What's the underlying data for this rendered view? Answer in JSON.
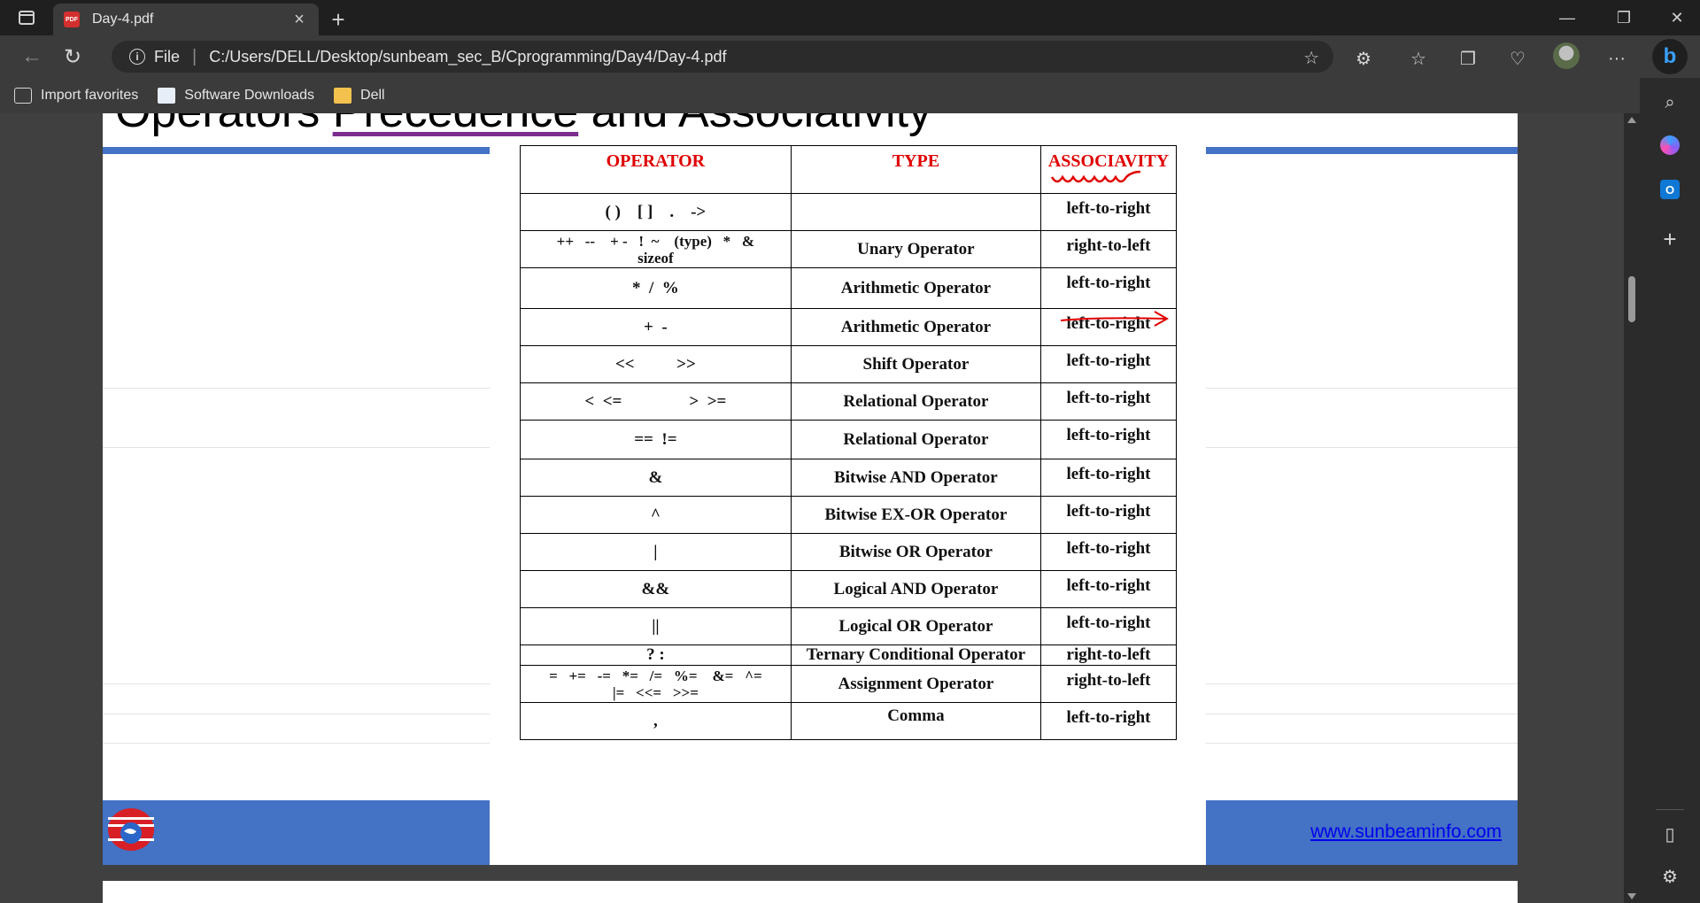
{
  "browser": {
    "tab_title": "Day-4.pdf",
    "tab_icon": "pdf-file-icon",
    "address": {
      "scheme_label": "File",
      "url": "C:/Users/DELL/Desktop/sunbeam_sec_B/Cprogramming/Day4/Day-4.pdf"
    },
    "bookmarks": [
      {
        "label": "Import favorites",
        "icon": "import-icon"
      },
      {
        "label": "Software Downloads",
        "icon": "page-icon"
      },
      {
        "label": "Dell",
        "icon": "folder-icon"
      }
    ],
    "window_controls": {
      "minimize": "—",
      "restore": "❐",
      "close": "✕"
    }
  },
  "slide": {
    "title_part1": "Operators ",
    "title_part2": "Precedence",
    "title_part3": " and Associativity",
    "footer_link": "www.sunbeaminfo.com",
    "accent_color": "#4472c4",
    "header_color": "#e00000"
  },
  "table": {
    "headers": [
      "OPERATOR",
      "TYPE",
      "ASSOCIAVITY"
    ],
    "rows": [
      {
        "op": "( )    [ ]    .    ->",
        "type": "",
        "assoc": "left-to-right"
      },
      {
        "op": "++   --    + -   !  ~    (type)   *   &\nsizeof",
        "type": "Unary Operator",
        "assoc": "right-to-left"
      },
      {
        "op": "*  /  %",
        "type": "Arithmetic Operator",
        "assoc": "left-to-right"
      },
      {
        "op": "+  -",
        "type": "Arithmetic Operator",
        "assoc": "left-to-right"
      },
      {
        "op": "<<          >>",
        "type": "Shift Operator",
        "assoc": "left-to-right"
      },
      {
        "op": "<  <=                >  >=",
        "type": "Relational Operator",
        "assoc": "left-to-right"
      },
      {
        "op": "==  !=",
        "type": "Relational Operator",
        "assoc": "left-to-right"
      },
      {
        "op": "&",
        "type": "Bitwise AND Operator",
        "assoc": "left-to-right"
      },
      {
        "op": "^",
        "type": "Bitwise EX-OR Operator",
        "assoc": "left-to-right"
      },
      {
        "op": "|",
        "type": "Bitwise OR Operator",
        "assoc": "left-to-right"
      },
      {
        "op": "&&",
        "type": "Logical AND Operator",
        "assoc": "left-to-right"
      },
      {
        "op": "||",
        "type": "Logical OR Operator",
        "assoc": "left-to-right"
      },
      {
        "op": "? :",
        "type": "Ternary Conditional Operator",
        "assoc": "right-to-left"
      },
      {
        "op": "=   +=   -=   *=   /=   %=    &=   ^=\n|=   <<=   >>=",
        "type": "Assignment Operator",
        "assoc": "right-to-left"
      },
      {
        "op": ",",
        "type": "Comma",
        "assoc": "left-to-right"
      }
    ]
  }
}
